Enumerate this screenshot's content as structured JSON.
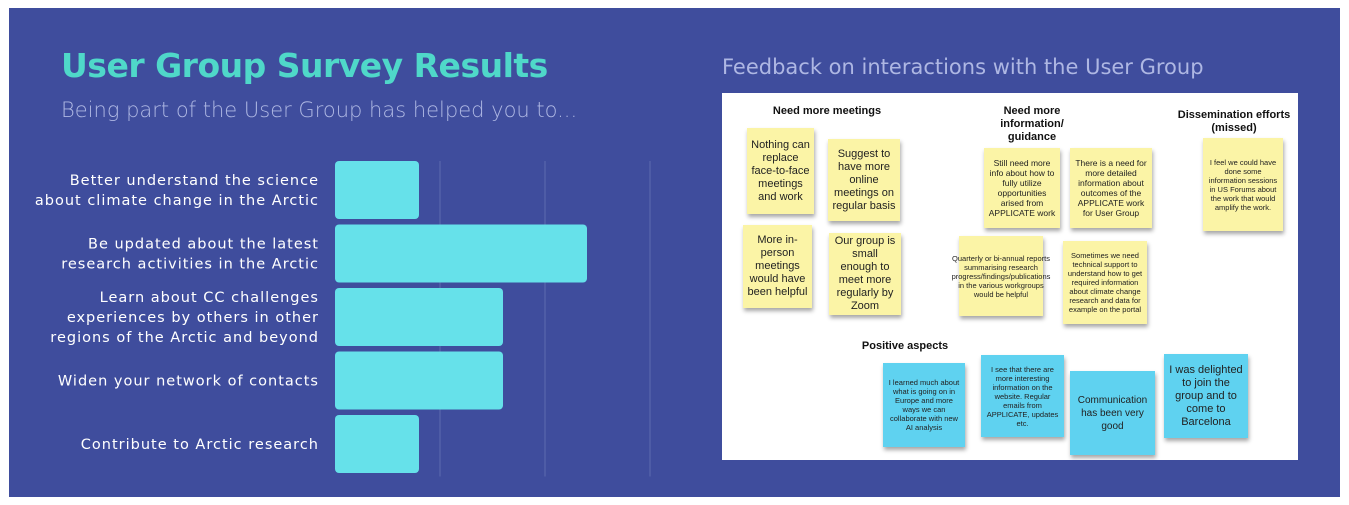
{
  "left": {
    "title": "User Group Survey Results",
    "subtitle": "Being part of the User Group has helped you to..."
  },
  "chart_data": {
    "type": "bar",
    "orientation": "horizontal",
    "categories": [
      [
        "Better understand the science",
        "about climate change in the Arctic"
      ],
      [
        "Be updated about the latest",
        "research activities in the Arctic"
      ],
      [
        "Learn about CC challenges",
        "experiences by others in other",
        "regions of the Arctic and beyond"
      ],
      [
        "Widen your network of contacts"
      ],
      [
        "Contribute to Arctic research"
      ]
    ],
    "values": [
      4,
      12,
      8,
      8,
      4
    ],
    "xlim": [
      0,
      15
    ],
    "grid": true,
    "bar_color": "#66e1ea"
  },
  "right": {
    "title": "Feedback on interactions with the User Group",
    "headings": {
      "meetings": "Need more meetings",
      "information": "Need more information/ guidance",
      "dissemination": "Dissemination efforts (missed)",
      "positive": "Positive aspects"
    },
    "notes": [
      "Nothing can replace face-to-face meetings and work",
      "Suggest to have more online meetings on regular basis",
      "More in-person meetings would have been helpful",
      "Our group is small enough to meet more regularly by Zoom",
      "Still need more info about how to fully utilize opportunities arised from APPLICATE work",
      "There is a need for more detailed information about outcomes of the APPLICATE work for User Group",
      "Quarterly or bi-annual reports summarising research progress/findings/publications in the various workgroups would be helpful",
      "Sometimes we need technical support to understand how to get required information about climate change research and data for example on the portal",
      "I feel we could have done some information sessions in US Forums about the work that would amplify the work.",
      "I learned much about what is going on in Europe and more ways we can collaborate with new AI analysis",
      "I see that there are more interesting information on the website. Regular emails from APPLICATE, updates etc.",
      "Communication has been very good",
      "I was delighted to join the group and to come to Barcelona"
    ]
  },
  "colors": {
    "background": "#3f4d9d",
    "title": "#4fd8c9",
    "bar": "#66e1ea",
    "note_yellow": "#fbf4a6",
    "note_blue": "#5fd2f0"
  }
}
